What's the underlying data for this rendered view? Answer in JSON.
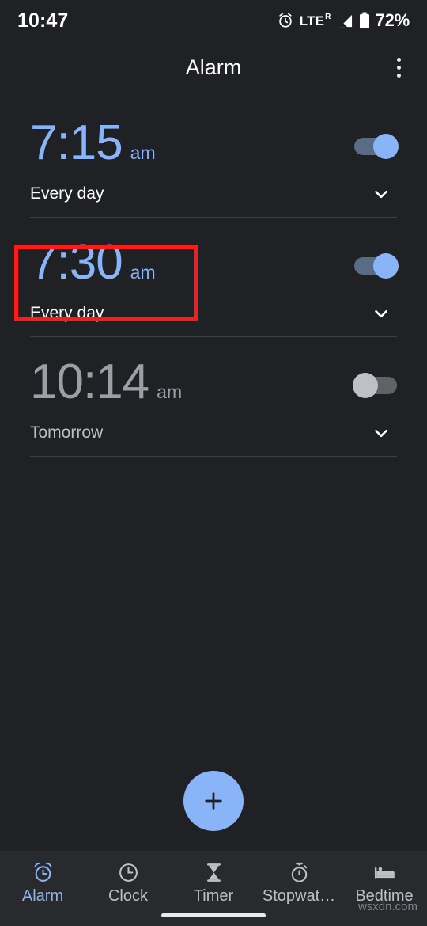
{
  "statusbar": {
    "time": "10:47",
    "network": "LTE",
    "roaming": "R",
    "battery": "72%",
    "icons": [
      "alarm-set-icon",
      "signal-icon",
      "battery-icon"
    ]
  },
  "appbar": {
    "title": "Alarm",
    "overflow_label": "More options"
  },
  "alarms": [
    {
      "time": "7:15",
      "ampm": "am",
      "schedule": "Every day",
      "enabled": true,
      "highlighted": false
    },
    {
      "time": "7:30",
      "ampm": "am",
      "schedule": "Every day",
      "enabled": true,
      "highlighted": true
    },
    {
      "time": "10:14",
      "ampm": "am",
      "schedule": "Tomorrow",
      "enabled": false,
      "highlighted": false
    }
  ],
  "fab": {
    "label": "+",
    "name": "add-alarm-button"
  },
  "bottom_nav": {
    "items": [
      {
        "label": "Alarm",
        "icon": "alarm-clock-icon",
        "active": true
      },
      {
        "label": "Clock",
        "icon": "clock-icon",
        "active": false
      },
      {
        "label": "Timer",
        "icon": "hourglass-icon",
        "active": false
      },
      {
        "label": "Stopwat…",
        "icon": "stopwatch-icon",
        "active": false
      },
      {
        "label": "Bedtime",
        "icon": "bed-icon",
        "active": false
      }
    ]
  },
  "watermark": "wsxdn.com",
  "colors": {
    "background": "#202124",
    "nav_background": "#282a2d",
    "accent": "#8ab4f8",
    "disabled_text": "#9aa0a6",
    "annotation": "#ff1a1a",
    "divider": "#3c4043"
  }
}
